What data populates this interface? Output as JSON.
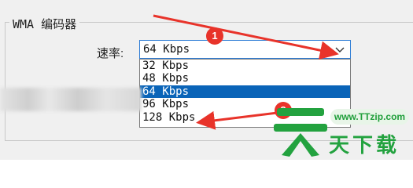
{
  "group": {
    "title": "WMA 编码器"
  },
  "rate": {
    "label": "速率:",
    "selected_value": "64 Kbps",
    "options": [
      "32 Kbps",
      "48 Kbps",
      "64 Kbps",
      "96 Kbps",
      "128 Kbps"
    ],
    "selected_index": 2
  },
  "annotations": {
    "step1": "1",
    "step2": "2"
  },
  "watermark": {
    "url": "www.TTzip.com",
    "text": "天下载"
  },
  "colors": {
    "arrow": "#e8332a",
    "selection": "#0a64b8",
    "watermark": "#23a23f"
  }
}
